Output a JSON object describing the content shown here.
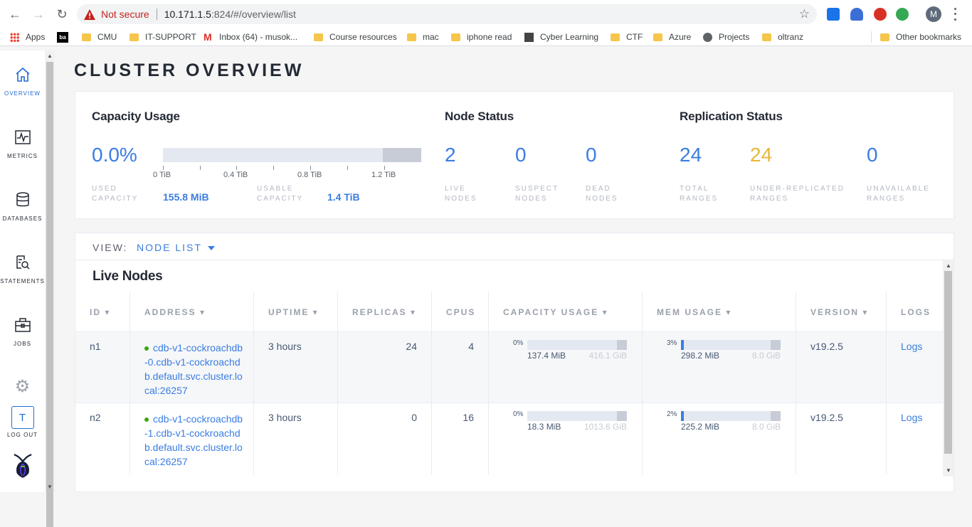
{
  "browser": {
    "not_secure": "Not secure",
    "url_host": "10.171.1.5",
    "url_rest": ":824/#/overview/list",
    "profile_initial": "M",
    "bookmarks": [
      {
        "label": "Apps",
        "icon": "apps-grid-icon"
      },
      {
        "label": "",
        "icon": "ba-icon"
      },
      {
        "label": "CMU",
        "icon": "folder-icon"
      },
      {
        "label": "IT-SUPPORT",
        "icon": "folder-icon"
      },
      {
        "label": "Inbox (64) - musok...",
        "icon": "gmail-icon"
      },
      {
        "label": "Course resources",
        "icon": "folder-icon"
      },
      {
        "label": "mac",
        "icon": "folder-icon"
      },
      {
        "label": "iphone read",
        "icon": "folder-icon"
      },
      {
        "label": "Cyber Learning",
        "icon": "page-icon"
      },
      {
        "label": "CTF",
        "icon": "folder-icon"
      },
      {
        "label": "Azure",
        "icon": "folder-icon"
      },
      {
        "label": "Projects",
        "icon": "globe-icon"
      },
      {
        "label": "oltranz",
        "icon": "folder-icon"
      }
    ],
    "other_bookmarks": "Other bookmarks",
    "ba_text": "ba"
  },
  "sidebar": {
    "items": [
      {
        "label": "OVERVIEW"
      },
      {
        "label": "METRICS"
      },
      {
        "label": "DATABASES"
      },
      {
        "label": "STATEMENTS"
      },
      {
        "label": "JOBS"
      },
      {
        "label": "LOG OUT"
      }
    ],
    "user_initial": "T"
  },
  "page": {
    "title": "CLUSTER OVERVIEW"
  },
  "capacity": {
    "title": "Capacity Usage",
    "percent": "0.0%",
    "ticks": [
      "0 TiB",
      "0.4 TiB",
      "0.8 TiB",
      "1.2 TiB"
    ],
    "used_label_1": "USED",
    "used_label_2": "CAPACITY",
    "used_value": "155.8 MiB",
    "usable_label_1": "USABLE",
    "usable_label_2": "CAPACITY",
    "usable_value": "1.4 TiB"
  },
  "node_status": {
    "title": "Node Status",
    "live": {
      "value": "2",
      "l1": "LIVE",
      "l2": "NODES"
    },
    "suspect": {
      "value": "0",
      "l1": "SUSPECT",
      "l2": "NODES"
    },
    "dead": {
      "value": "0",
      "l1": "DEAD",
      "l2": "NODES"
    }
  },
  "replication": {
    "title": "Replication Status",
    "total": {
      "value": "24",
      "l1": "TOTAL",
      "l2": "RANGES"
    },
    "under": {
      "value": "24",
      "l1": "UNDER-REPLICATED",
      "l2": "RANGES"
    },
    "unavailable": {
      "value": "0",
      "l1": "UNAVAILABLE",
      "l2": "RANGES"
    }
  },
  "view": {
    "label": "VIEW:",
    "selected": "NODE LIST"
  },
  "live_nodes": {
    "title": "Live Nodes",
    "columns": [
      "ID ▾",
      "ADDRESS ▾",
      "UPTIME ▾",
      "REPLICAS ▾",
      "CPUS",
      "CAPACITY USAGE ▾",
      "MEM USAGE ▾",
      "VERSION ▾",
      "LOGS"
    ],
    "rows": [
      {
        "id": "n1",
        "address": "cdb-v1-cockroachdb-0.cdb-v1-cockroachdb.default.svc.cluster.local:26257",
        "uptime": "3 hours",
        "replicas": "24",
        "cpus": "4",
        "cap_pct": "0%",
        "cap_fraction": 0.0,
        "cap_used": "137.4 MiB",
        "cap_total": "416.1 GiB",
        "mem_pct": "3%",
        "mem_fraction": 0.03,
        "mem_used": "298.2 MiB",
        "mem_total": "8.0 GiB",
        "version": "v19.2.5",
        "logs": "Logs"
      },
      {
        "id": "n2",
        "address": "cdb-v1-cockroachdb-1.cdb-v1-cockroachdb.default.svc.cluster.local:26257",
        "uptime": "3 hours",
        "replicas": "0",
        "cpus": "16",
        "cap_pct": "0%",
        "cap_fraction": 0.0,
        "cap_used": "18.3 MiB",
        "cap_total": "1013.6 GiB",
        "mem_pct": "2%",
        "mem_fraction": 0.02,
        "mem_used": "225.2 MiB",
        "mem_total": "8.0 GiB",
        "version": "v19.2.5",
        "logs": "Logs"
      }
    ]
  }
}
